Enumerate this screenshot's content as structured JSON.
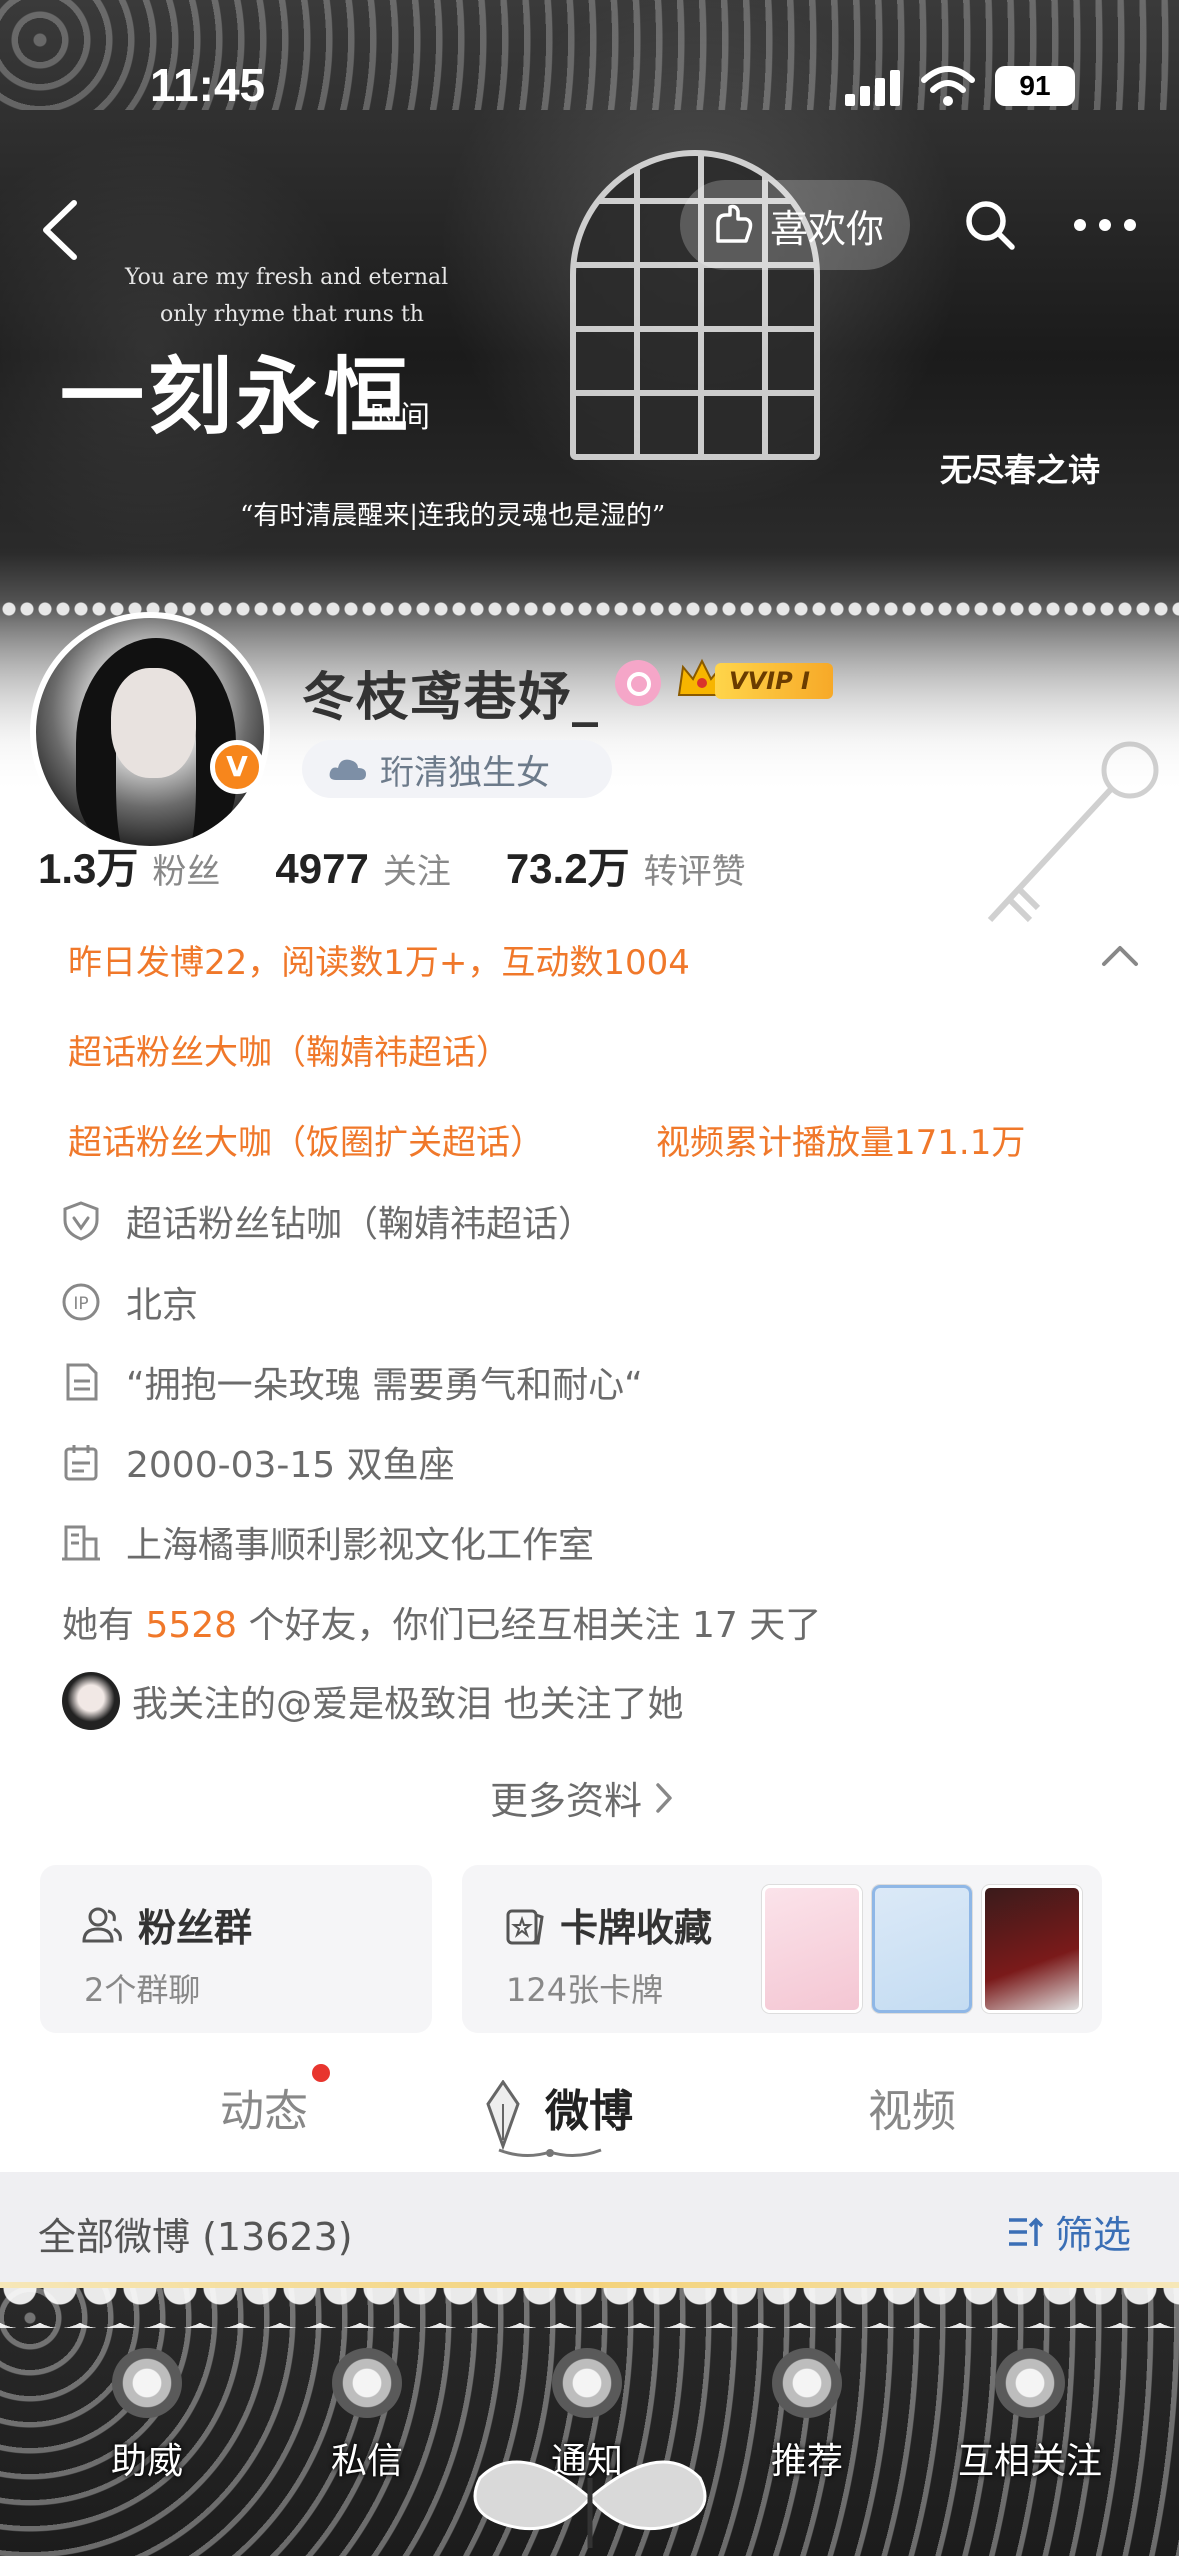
{
  "status_bar": {
    "time": "11:45",
    "battery": "91"
  },
  "banner": {
    "line1": "You are my fresh and eternal",
    "line2": "only rhyme that runs th",
    "title": "一刻永恒",
    "subtitle": "时间",
    "quote": "“有时清晨醒来|连我的灵魂也是湿的”",
    "poem": "无尽春之诗"
  },
  "nav": {
    "like_label": "喜欢你"
  },
  "profile": {
    "username": "冬枝鸢巷妤_",
    "vip": "VVIP I",
    "verified_mark": "V",
    "tag": "珩清独生女",
    "stats": [
      {
        "num": "1.3万",
        "label": "粉丝"
      },
      {
        "num": "4977",
        "label": "关注"
      },
      {
        "num": "73.2万",
        "label": "转评赞"
      }
    ]
  },
  "achievements": {
    "line1": "昨日发博22，阅读数1万+，互动数1004",
    "line2": "超话粉丝大咖（鞠婧祎超话）",
    "line3a": "超话粉丝大咖（饭圈扩关超话）",
    "line3b": "视频累计播放量171.1万"
  },
  "info": {
    "diamond": "超话粉丝钻咖（鞠婧祎超话）",
    "ip": "北京",
    "bio": "“拥抱一朵玫瑰 需要勇气和耐心“",
    "birthday": "2000-03-15 双鱼座",
    "company": "上海橘事顺利影视文化工作室",
    "friends_prefix": "她有",
    "friends_count": "5528",
    "friends_suffix": "个好友，你们已经互相关注 17 天了",
    "mutual": "我关注的@爱是极致泪 也关注了她",
    "more": "更多资料"
  },
  "cards": {
    "fans_title": "粉丝群",
    "fans_sub": "2个群聊",
    "cards_title": "卡牌收藏",
    "cards_sub": "124张卡牌"
  },
  "tabs": [
    "动态",
    "微博",
    "视频"
  ],
  "filter": {
    "label": "全部微博 (13623)",
    "button": "筛选"
  },
  "bottom_nav": [
    "助威",
    "私信",
    "通知",
    "推荐",
    "互相关注"
  ],
  "colors": {
    "accent_orange": "#f0782a",
    "link_blue": "#3b6fb6",
    "verified_orange": "#f7861c",
    "notify_red": "#e8352e"
  }
}
